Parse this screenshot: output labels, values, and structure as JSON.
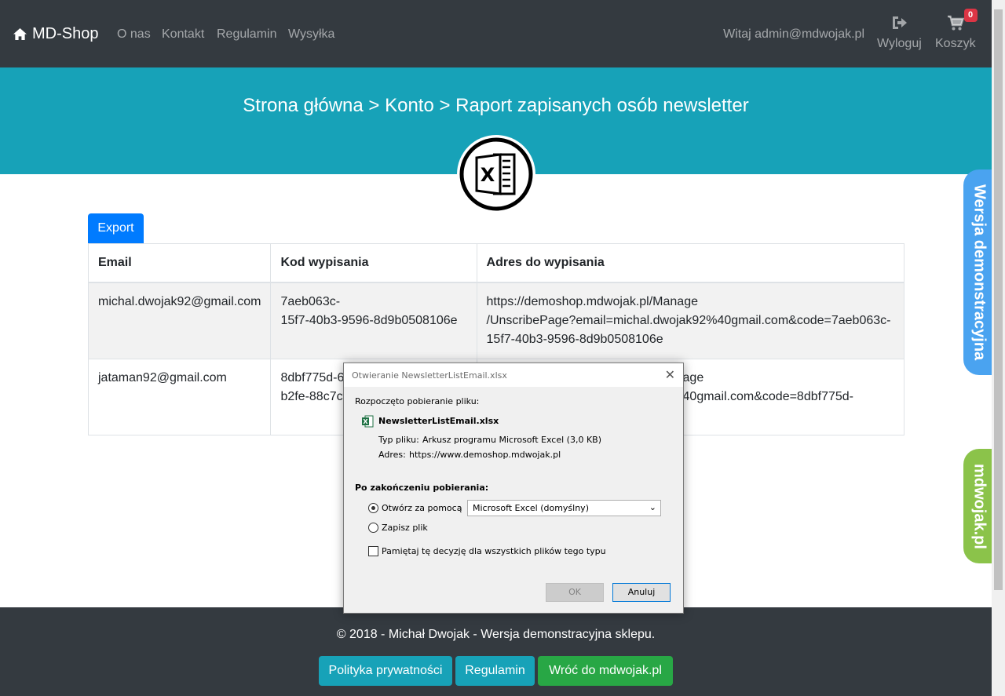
{
  "navbar": {
    "brand": "MD-Shop",
    "links": [
      "O nas",
      "Kontakt",
      "Regulamin",
      "Wysyłka"
    ],
    "welcome": "Witaj admin@mdwojak.pl",
    "logout_label": "Wyloguj",
    "cart_label": "Koszyk",
    "cart_count": "0"
  },
  "header": {
    "breadcrumb": "Strona główna > Konto > Raport zapisanych osób newsletter"
  },
  "main": {
    "export_label": "Export",
    "table": {
      "headers": [
        "Email",
        "Kod wypisania",
        "Adres do wypisania"
      ],
      "rows": [
        {
          "email": "michal.dwojak92@gmail.com",
          "code_line1": "7aeb063c-",
          "code_line2": "15f7-40b3-9596-8d9b0508106e",
          "url_line1": "https://demoshop.mdwojak.pl/Manage",
          "url_line2": "/UnscribePage?email=michal.dwojak92%40gmail.com&code=7aeb063c-",
          "url_line3": "15f7-40b3-9596-8d9b0508106e"
        },
        {
          "email": "jataman92@gmail.com",
          "code_line1": "8dbf775d-6",
          "code_line2": "b2fe-88c7cf",
          "url_line1": "age",
          "url_line2": "40gmail.com&code=8dbf775d-"
        }
      ]
    }
  },
  "side_tabs": {
    "demo": "Wersja demonstracyjna",
    "site": "mdwojak.pl"
  },
  "footer": {
    "copyright": "© 2018 - Michał Dwojak - Wersja demonstracyjna sklepu.",
    "privacy_label": "Polityka prywatności",
    "terms_label": "Regulamin",
    "back_label": "Wróć do mdwojak.pl"
  },
  "dialog": {
    "title": "Otwieranie NewsletterListEmail.xlsx",
    "intro": "Rozpoczęto pobieranie pliku:",
    "filename": "NewsletterListEmail.xlsx",
    "type_label": "Typ pliku:",
    "type_value": "Arkusz programu Microsoft Excel (3,0 KB)",
    "address_label": "Adres:",
    "address_value": "https://www.demoshop.mdwojak.pl",
    "after_heading": "Po zakończeniu pobierania:",
    "open_with_label": "Otwórz za pomocą",
    "open_with_value": "Microsoft Excel (domyślny)",
    "save_label": "Zapisz plik",
    "remember_label": "Pamiętaj tę decyzję dla wszystkich plików tego typu",
    "ok_label": "OK",
    "cancel_label": "Anuluj"
  }
}
